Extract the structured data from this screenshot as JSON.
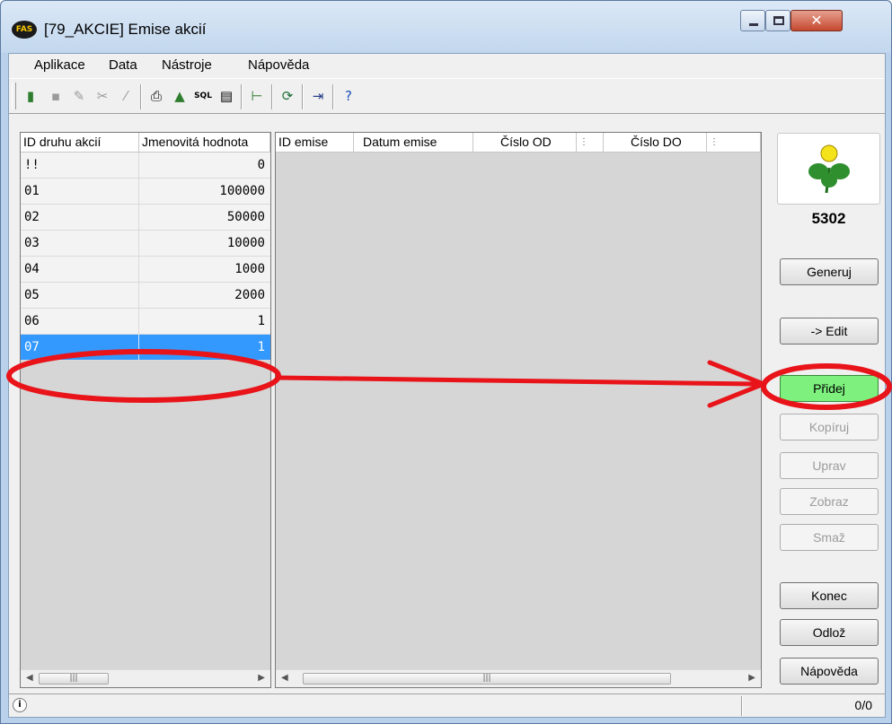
{
  "window": {
    "app_icon": "FAS",
    "title": "[79_AKCIE] Emise akcií"
  },
  "menu": [
    "Aplikace",
    "Data",
    "Nástroje",
    "Nápověda"
  ],
  "toolbar_icons": [
    "new-icon",
    "save-icon",
    "edit-icon",
    "tool-icon",
    "wand-icon",
    "print-icon",
    "export-icon",
    "sql-icon",
    "report-icon",
    "tree-icon",
    "refresh-icon",
    "exit-icon",
    "help-icon"
  ],
  "toolbar_sql": "SQL",
  "left_grid": {
    "columns": [
      "ID druhu akcií",
      "Jmenovitá hodnota"
    ],
    "rows": [
      [
        "!!",
        "0"
      ],
      [
        "01",
        "100000"
      ],
      [
        "02",
        "50000"
      ],
      [
        "03",
        "10000"
      ],
      [
        "04",
        "1000"
      ],
      [
        "05",
        "2000"
      ],
      [
        "06",
        "1"
      ],
      [
        "07",
        "1"
      ]
    ],
    "selected_row": "07"
  },
  "right_grid": {
    "columns": [
      "ID emise",
      "Datum emise",
      "Číslo OD",
      "Číslo DO"
    ],
    "rows": []
  },
  "side": {
    "code": "5302",
    "buttons": {
      "generuj": "Generuj",
      "edit": "-> Edit",
      "pridej": "Přidej",
      "kopiruj": "Kopíruj",
      "uprav": "Uprav",
      "zobraz": "Zobraz",
      "smaz": "Smaž",
      "konec": "Konec",
      "odloz": "Odlož",
      "napoveda": "Nápověda"
    }
  },
  "status": {
    "count": "0/0"
  },
  "colors": {
    "selection": "#3399ff",
    "highlight_button": "#7df07d",
    "annotation": "#e8141a"
  }
}
